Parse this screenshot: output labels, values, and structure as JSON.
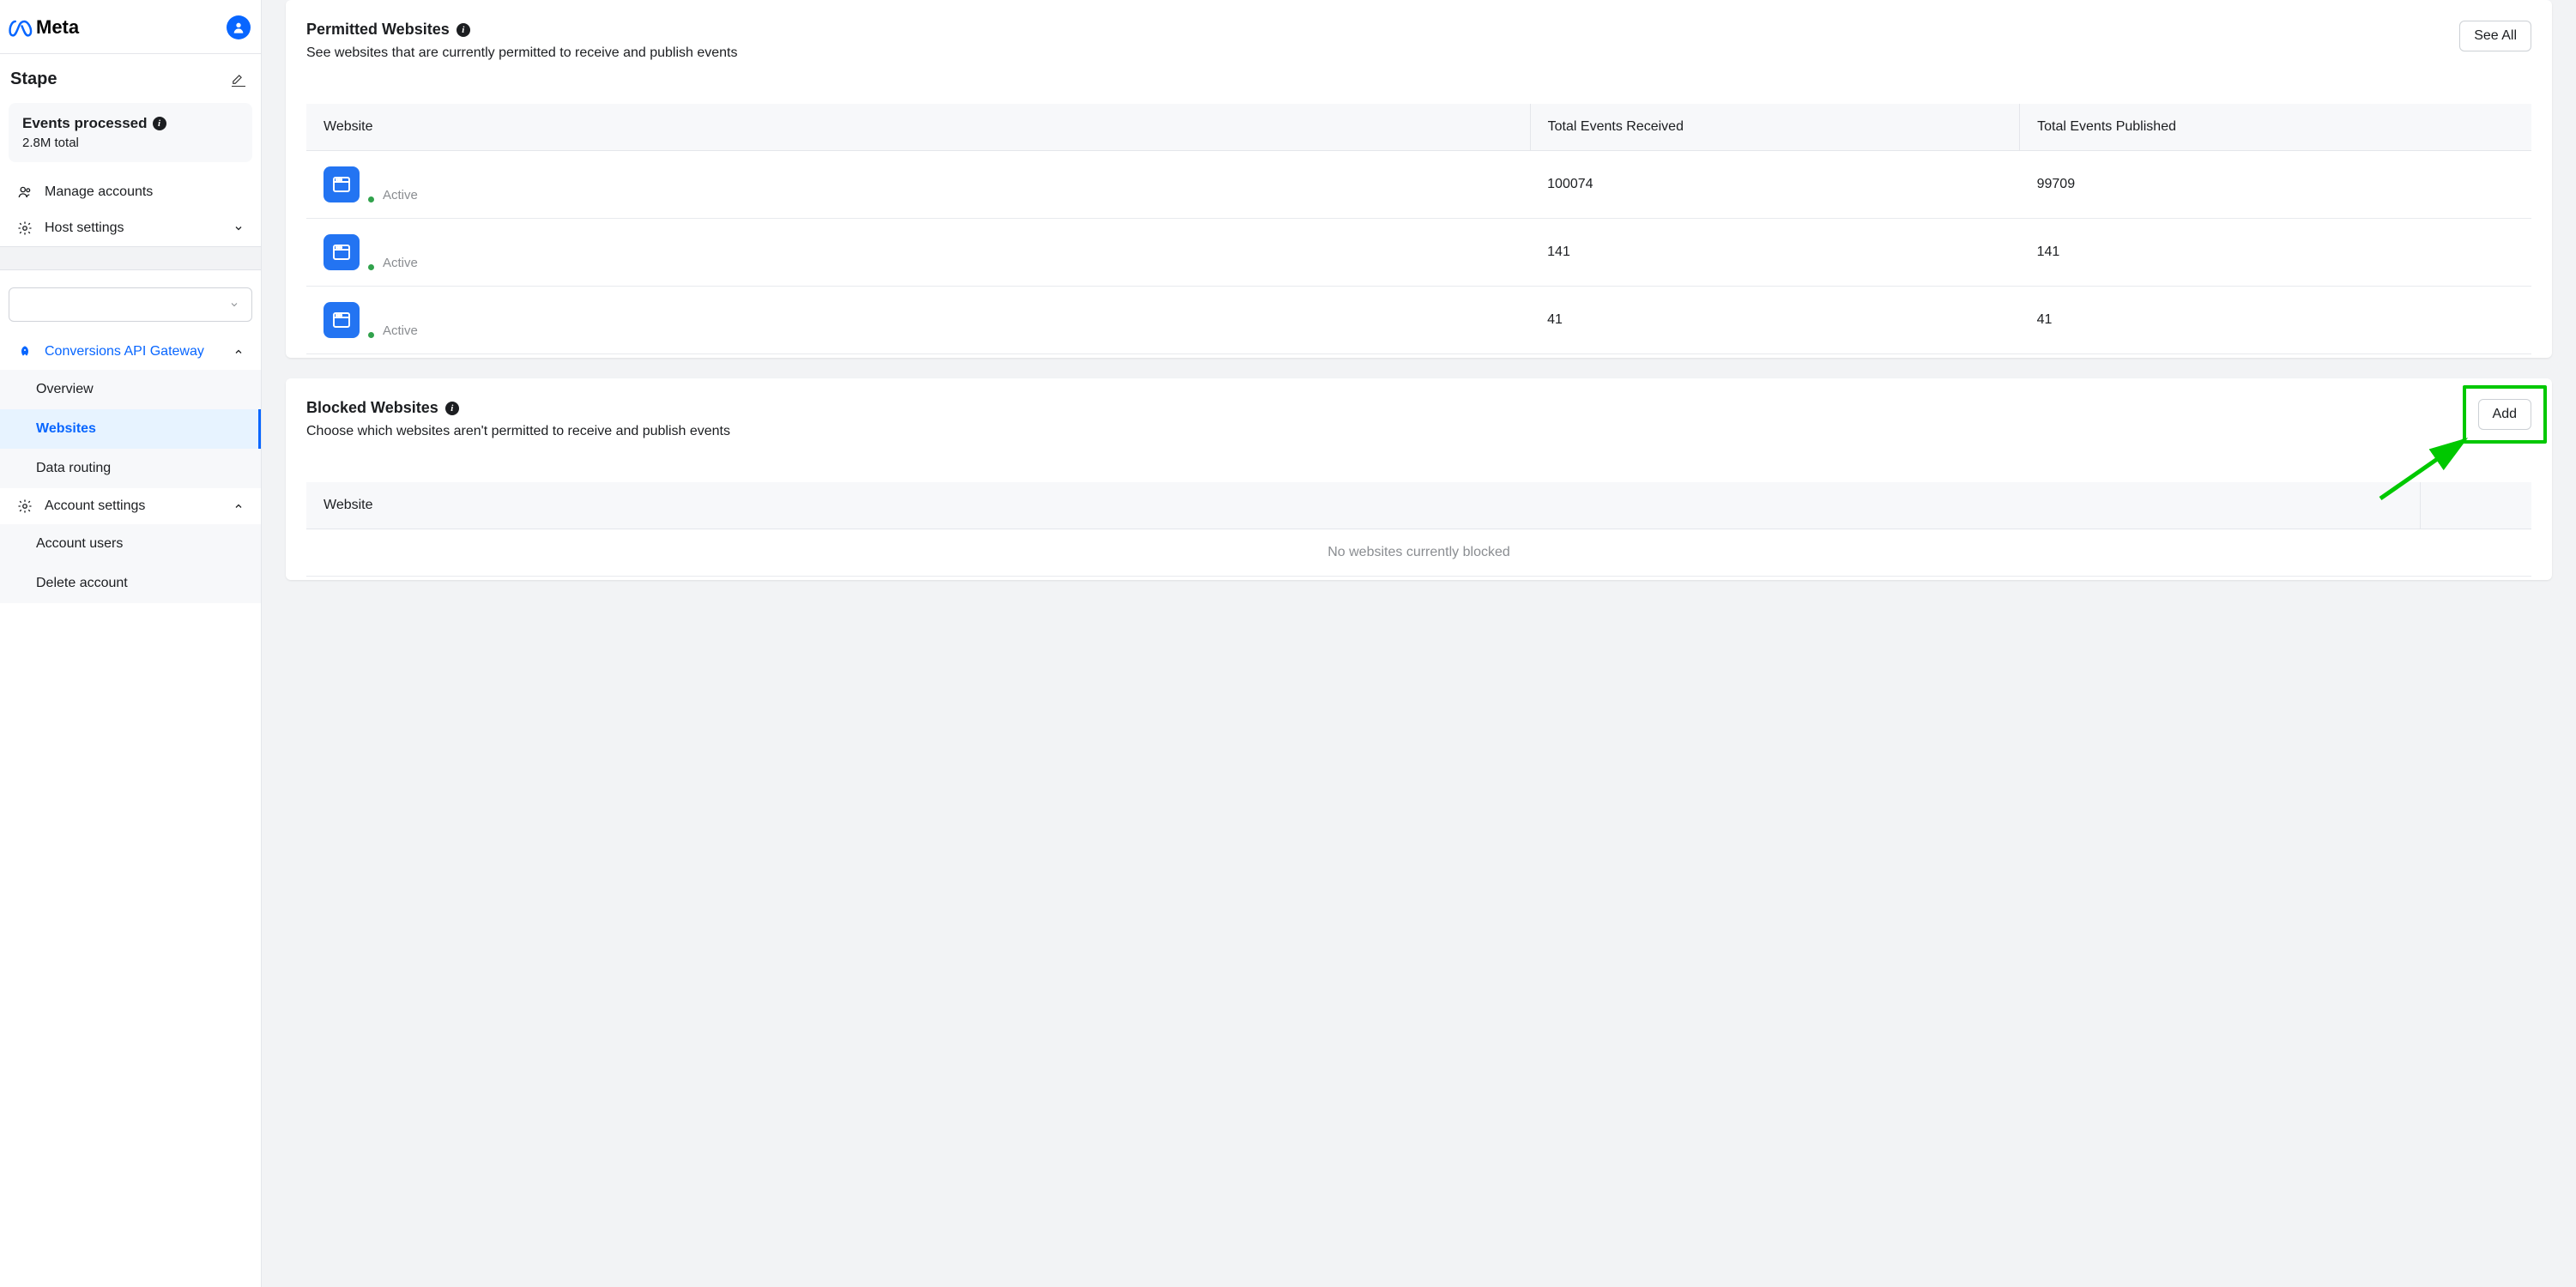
{
  "brand": "Meta",
  "account_name": "Stape",
  "stats": {
    "title": "Events processed",
    "subtitle": "2.8M total"
  },
  "nav": {
    "manage_accounts": "Manage accounts",
    "host_settings": "Host settings",
    "capi_gateway": "Conversions API Gateway",
    "overview": "Overview",
    "websites": "Websites",
    "data_routing": "Data routing",
    "account_settings": "Account settings",
    "account_users": "Account users",
    "delete_account": "Delete account"
  },
  "permitted": {
    "title": "Permitted Websites",
    "description": "See websites that are currently permitted to receive and publish events",
    "see_all_label": "See All",
    "columns": {
      "website": "Website",
      "received": "Total Events Received",
      "published": "Total Events Published"
    },
    "status_label": "Active",
    "rows": [
      {
        "received": "100074",
        "published": "99709"
      },
      {
        "received": "141",
        "published": "141"
      },
      {
        "received": "41",
        "published": "41"
      }
    ]
  },
  "blocked": {
    "title": "Blocked Websites",
    "description": "Choose which websites aren't permitted to receive and publish events",
    "add_label": "Add",
    "columns": {
      "website": "Website"
    },
    "empty_text": "No websites currently blocked"
  }
}
